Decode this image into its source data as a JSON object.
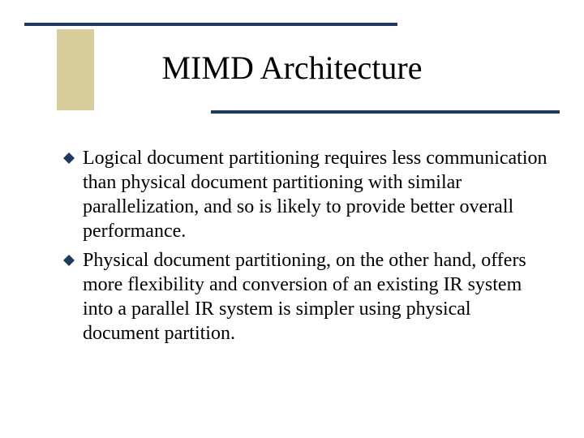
{
  "title": "MIMD Architecture",
  "bullets": [
    "Logical document partitioning requires less communication than physical document partitioning with similar parallelization, and so is likely to provide better overall performance.",
    "Physical document partitioning, on the other hand, offers more flexibility and conversion of an existing IR system into a parallel IR system is simpler using physical document partition."
  ]
}
